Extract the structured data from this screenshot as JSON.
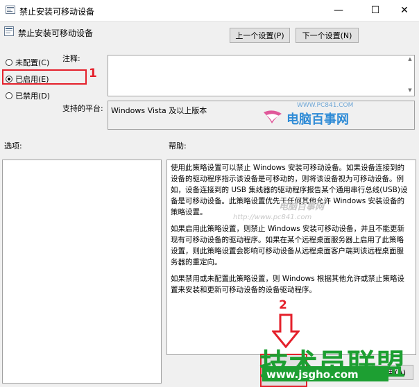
{
  "window": {
    "title": "禁止安装可移动设备",
    "controls": {
      "minimize": "—",
      "maximize": "☐",
      "close": "✕"
    }
  },
  "header": {
    "title": "禁止安装可移动设备",
    "prev_button": "上一个设置(P)",
    "next_button": "下一个设置(N)"
  },
  "state": {
    "options": [
      {
        "label": "未配置(C)",
        "selected": false
      },
      {
        "label": "已启用(E)",
        "selected": true
      },
      {
        "label": "已禁用(D)",
        "selected": false
      }
    ]
  },
  "comment": {
    "label": "注释:"
  },
  "platform": {
    "label": "支持的平台:",
    "value": "Windows Vista 及以上版本"
  },
  "sections": {
    "options_label": "选项:",
    "help_label": "帮助:"
  },
  "help": {
    "paragraphs": [
      "使用此策略设置可以禁止 Windows 安装可移动设备。如果设备连接到的设备的驱动程序指示该设备是可移动的，则将该设备视为可移动设备。例如，设备连接到的 USB 集线器的驱动程序报告某个通用串行总线(USB)设备是可移动设备。此策略设置优先于任何其他允许 Windows 安装设备的策略设置。",
      "如果启用此策略设置，则禁止 Windows 安装可移动设备，并且不能更新现有可移动设备的驱动程序。如果在某个远程桌面服务器上启用了此策略设置，则此策略设置会影响可移动设备从远程桌面客户端到该远程桌面服务器的重定向。",
      "如果禁用或未配置此策略设置，则 Windows 根据其他允许或禁止策略设置来安装和更新可移动设备的设备驱动程序。"
    ]
  },
  "annotations": {
    "step1": "1",
    "step2": "2"
  },
  "bottom": {
    "apply_button": "应用(A)"
  },
  "watermarks": {
    "top_url": "WWW.PC841.COM",
    "top_name": "电脑百事网",
    "mid_name": "电脑百事网",
    "mid_url": "http://www.pc841.com",
    "bottom_name": "技术员联盟",
    "bottom_url": "www.jsgho.com"
  },
  "colors": {
    "annotation_red": "#e4202b",
    "watermark_green": "#1d9f32",
    "watermark_blue": "#2e8bd6"
  }
}
